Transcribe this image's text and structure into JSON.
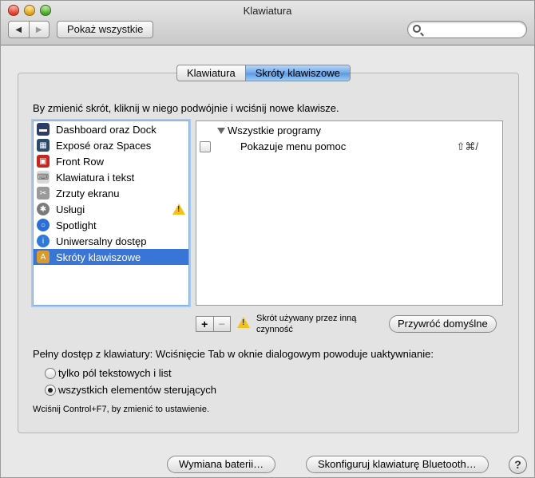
{
  "window": {
    "title": "Klawiatura"
  },
  "toolbar": {
    "back_glyph": "◀",
    "forward_glyph": "▶",
    "show_all_label": "Pokaż wszystkie",
    "search_value": "",
    "search_placeholder": ""
  },
  "tabs": [
    {
      "label": "Klawiatura",
      "active": false
    },
    {
      "label": "Skróty klawiszowe",
      "active": true
    }
  ],
  "instructions": "By zmienić skrót, kliknij w niego podwójnie i wciśnij nowe klawisze.",
  "categories": [
    {
      "label": "Dashboard oraz Dock",
      "icon": "dashboard-icon",
      "color": "#2d3d6a"
    },
    {
      "label": "Exposé oraz Spaces",
      "icon": "expose-icon",
      "color": "#2a4a6e"
    },
    {
      "label": "Front Row",
      "icon": "front-row-icon",
      "color": "#c2281f"
    },
    {
      "label": "Klawiatura i tekst",
      "icon": "keyboard-icon",
      "color": "#d9d9d9"
    },
    {
      "label": "Zrzuty ekranu",
      "icon": "screenshot-icon",
      "color": "#9a9a9a"
    },
    {
      "label": "Usługi",
      "icon": "gear-icon",
      "color": "#7a7a7a",
      "warning": true
    },
    {
      "label": "Spotlight",
      "icon": "spotlight-icon",
      "color": "#2b6fd6"
    },
    {
      "label": "Uniwersalny dostęp",
      "icon": "accessibility-icon",
      "color": "#2f7ad6"
    },
    {
      "label": "Skróty klawiszowe",
      "icon": "app-shortcuts-icon",
      "color": "#d99a2b",
      "selected": true
    }
  ],
  "shortcuts": {
    "group_label": "Wszystkie programy",
    "items": [
      {
        "label": "Pokazuje menu pomoc",
        "keys": "⇧⌘/",
        "checked": false
      }
    ]
  },
  "controls": {
    "add_label": "+",
    "remove_label": "−",
    "conflict_note": "Skrót używany przez inną czynność",
    "restore_label": "Przywróć domyślne"
  },
  "full_access": {
    "label": "Pełny dostęp z klawiatury: Wciśnięcie Tab w oknie dialogowym powoduje uaktywnianie:",
    "options": [
      {
        "label": "tylko pól tekstowych i list",
        "selected": false
      },
      {
        "label": "wszystkich elementów sterujących",
        "selected": true
      }
    ],
    "hint": "Wciśnij Control+F7, by zmienić to ustawienie."
  },
  "footer": {
    "battery_label": "Wymiana baterii…",
    "bluetooth_label": "Skonfiguruj klawiaturę Bluetooth…",
    "help_label": "?"
  }
}
